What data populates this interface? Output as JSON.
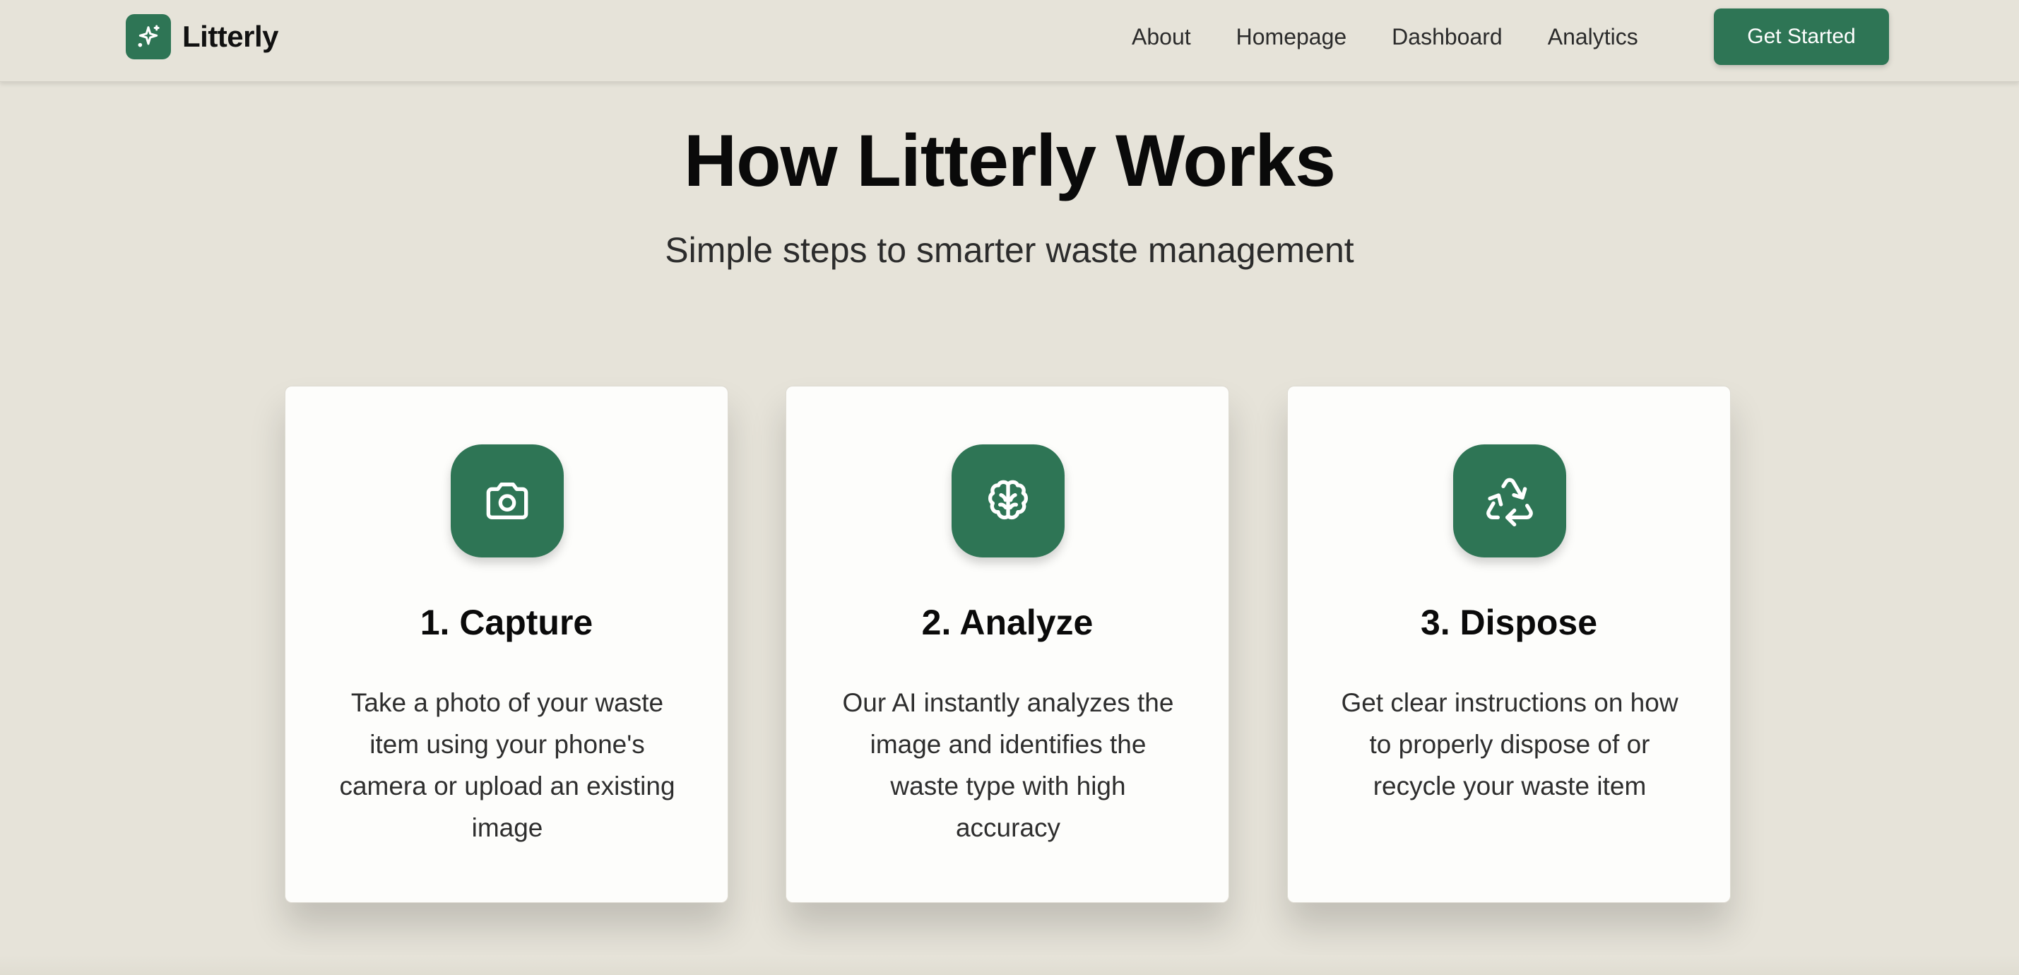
{
  "brand": {
    "name": "Litterly",
    "logo_icon": "sparkles-icon"
  },
  "nav": {
    "links": [
      "About",
      "Homepage",
      "Dashboard",
      "Analytics"
    ],
    "cta_label": "Get Started"
  },
  "hero": {
    "title": "How Litterly Works",
    "subtitle": "Simple steps to smarter waste management"
  },
  "steps": [
    {
      "icon": "camera-icon",
      "title": "1. Capture",
      "description": "Take a photo of your waste item using your phone's camera or upload an existing image"
    },
    {
      "icon": "brain-icon",
      "title": "2. Analyze",
      "description": "Our AI instantly analyzes the image and identifies the waste type with high accuracy"
    },
    {
      "icon": "recycle-icon",
      "title": "3. Dispose",
      "description": "Get clear instructions on how to properly dispose of or recycle your waste item"
    }
  ],
  "colors": {
    "accent": "#2e7555",
    "background": "#e6e3d9",
    "card": "#fdfdfb"
  }
}
